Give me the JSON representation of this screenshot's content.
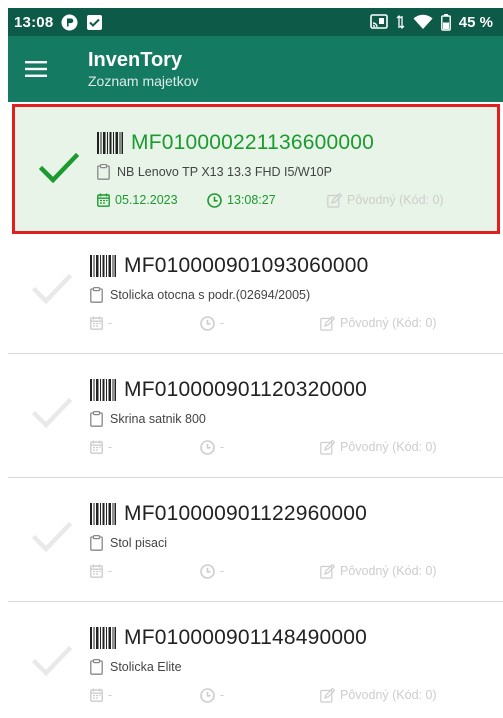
{
  "statusbar": {
    "time": "13:08",
    "battery": "45 %"
  },
  "appbar": {
    "title": "InvenTory",
    "subtitle": "Zoznam majetkov"
  },
  "items": [
    {
      "code": "MF010000221136600000",
      "name": "NB Lenovo TP X13 13.3 FHD I5/W10P",
      "date": "05.12.2023",
      "time": "13:08:27",
      "status": "Pôvodný (Kód: 0)",
      "checked": true
    },
    {
      "code": "MF010000901093060000",
      "name": "Stolicka otocna s podr.(02694/2005)",
      "date": "-",
      "time": "-",
      "status": "Pôvodný (Kód: 0)",
      "checked": false
    },
    {
      "code": "MF010000901120320000",
      "name": "Skrina satnik 800",
      "date": "-",
      "time": "-",
      "status": "Pôvodný (Kód: 0)",
      "checked": false
    },
    {
      "code": "MF010000901122960000",
      "name": "Stol pisaci",
      "date": "-",
      "time": "-",
      "status": "Pôvodný (Kód: 0)",
      "checked": false
    },
    {
      "code": "MF010000901148490000",
      "name": "Stolicka Elite",
      "date": "-",
      "time": "-",
      "status": "Pôvodný (Kód: 0)",
      "checked": false
    }
  ],
  "colors": {
    "statusbar": "#0e5a48",
    "appbar": "#157a62",
    "accent_green": "#1c9a30",
    "selection_border": "#e0201f",
    "selected_bg": "#e7f4e7"
  }
}
